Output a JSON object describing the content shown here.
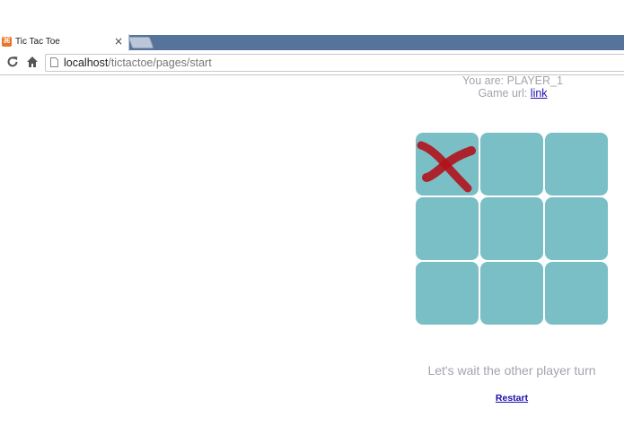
{
  "browser": {
    "tab_title": "Tic Tac Toe",
    "tab_close": "×",
    "url_host": "localhost",
    "url_path": "/tictactoe/pages/start"
  },
  "game": {
    "player_prefix": "You are: ",
    "player": "PLAYER_1",
    "url_prefix": "Game url: ",
    "url_link_label": "link",
    "status": "Let's wait the other player turn",
    "restart_label": "Restart",
    "board": [
      "X",
      "",
      "",
      "",
      "",
      "",
      "",
      "",
      ""
    ],
    "colors": {
      "cell": "#7abfc6",
      "x_mark": "#b0121b",
      "muted_text": "#a3a3ad",
      "link": "#1a0dab"
    }
  }
}
